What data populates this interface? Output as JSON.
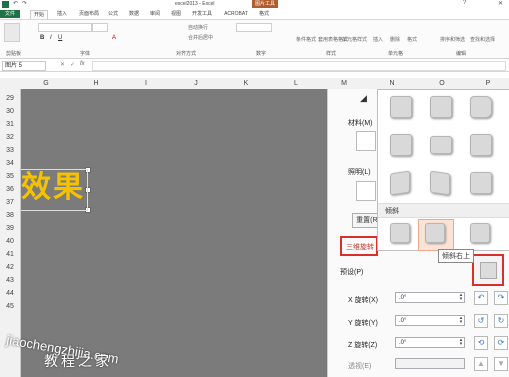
{
  "window": {
    "title": "excel2013 - Excel",
    "context_tab": "图片工具",
    "help": "?"
  },
  "tabs": [
    "文件",
    "开始",
    "插入",
    "页面布局",
    "公式",
    "数据",
    "审阅",
    "视图",
    "开发工具",
    "ACROBAT",
    "格式"
  ],
  "ribbon_groups": [
    "剪贴板",
    "字体",
    "对齐方式",
    "数字",
    "样式",
    "单元格",
    "编辑"
  ],
  "ribbon_buttons": [
    "条件格式",
    "套用表格格式",
    "单元格样式",
    "插入",
    "删除",
    "格式",
    "排序和筛选",
    "查找和选择",
    "自动换行",
    "合并后居中"
  ],
  "formula_bar": {
    "name_box": "图片 5",
    "fx": "fx"
  },
  "columns": [
    "G",
    "H",
    "I",
    "J",
    "K",
    "L",
    "M",
    "N",
    "O",
    "P"
  ],
  "rows": [
    "29",
    "30",
    "31",
    "32",
    "33",
    "34",
    "35",
    "36",
    "37",
    "38",
    "39",
    "40",
    "41",
    "42",
    "43",
    "44",
    "45"
  ],
  "sheet_text": "效果",
  "format_pane": {
    "material_label": "材料(M)",
    "lighting_label": "照明(L)",
    "reset_button": "重置(R)",
    "rotation_header": "三维旋转",
    "preset_label": "预设(P)",
    "x_label": "X 旋转(X)",
    "x_value": ".0°",
    "y_label": "Y 旋转(Y)",
    "y_value": ".0°",
    "z_label": "Z 旋转(Z)",
    "z_value": ".0°",
    "perspective_label": "透视(E)"
  },
  "gallery": {
    "section_label": "倾斜",
    "tooltip": "倾斜右上"
  },
  "watermark": {
    "url": "jiaochengzhijia.com",
    "text": "教程之家"
  },
  "colors": {
    "highlight": "#f5c200",
    "accent_red": "#d9302c",
    "sheet_bg": "#7b7b7b"
  }
}
